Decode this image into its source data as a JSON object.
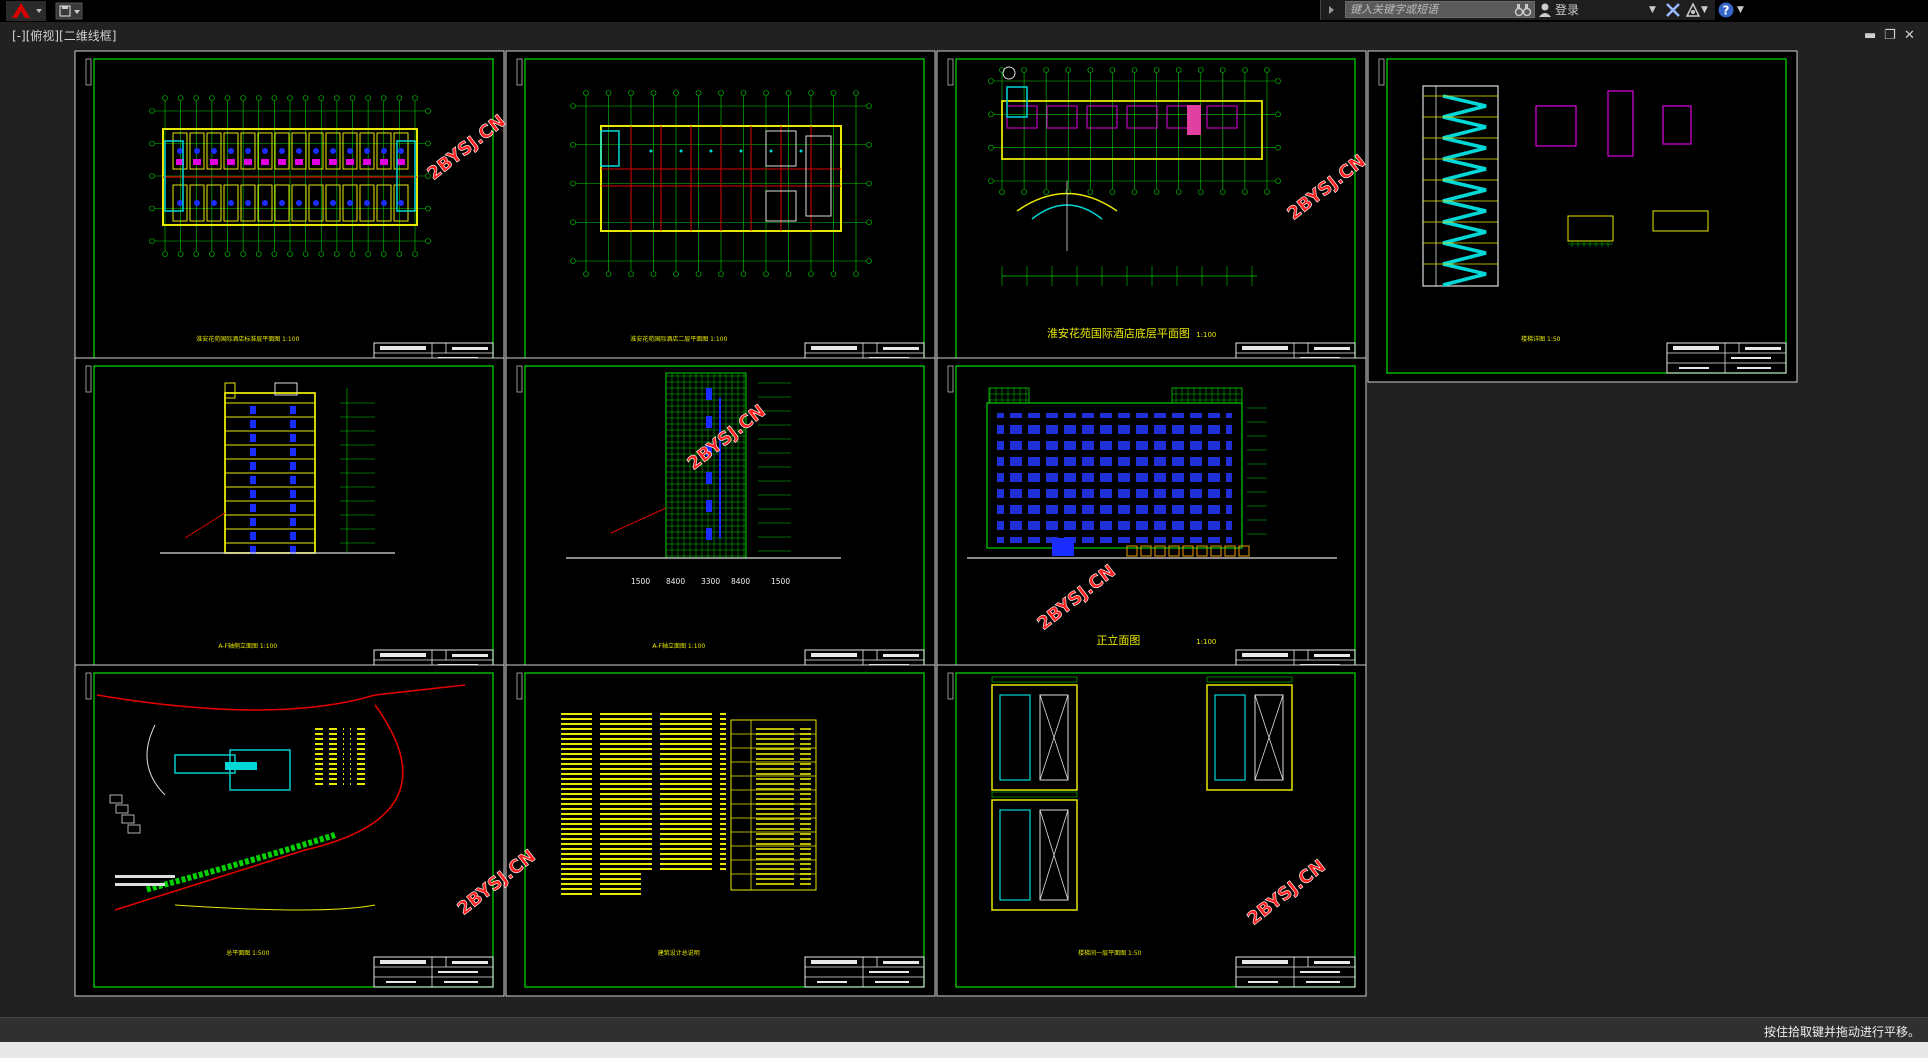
{
  "titlebar": {
    "search_placeholder": "键入关键字或短语",
    "login_label": "登录"
  },
  "viewport": {
    "view_label": "[-][俯视][二维线框]"
  },
  "colors": {
    "sheet_border": "#00d000",
    "cad_yellow": "#e8e800",
    "cad_red": "#e00000",
    "cad_blue": "#1a2cff",
    "cad_cyan": "#00d8d8",
    "cad_magenta": "#e000e0",
    "watermark": "#ff2020",
    "background": "#212121"
  },
  "sheets": [
    {
      "title": "淮安花苑国际酒店标准层平面图 1:100",
      "scale": ""
    },
    {
      "title": "淮安花苑国际酒店二层平面图 1:100",
      "scale": ""
    },
    {
      "title": "淮安花苑国际酒店底层平面图",
      "scale": "1:100"
    },
    {
      "title": "楼梯详图 1:50",
      "scale": ""
    },
    {
      "title": "A-F轴侧立面图 1:100",
      "scale": ""
    },
    {
      "title": "A-F轴立面图 1:100",
      "scale": ""
    },
    {
      "title": "正立面图",
      "scale": "1:100"
    },
    {
      "title": "总平面图 1:500",
      "scale": ""
    },
    {
      "title": "建筑设计总说明",
      "scale": ""
    },
    {
      "title": "楼梯间一层平面图 1:50",
      "scale": ""
    }
  ],
  "dims": {
    "elev_a": [
      "1500",
      "8400",
      "3300",
      "8400",
      "1500"
    ]
  },
  "watermarks": [
    "2BYSJ.CN",
    "2BYSJ.CN",
    "2BYSJ.CN",
    "2BYSJ.CN",
    "2BYSJ.CN",
    "2BYSJ.CN"
  ],
  "status": {
    "message": "按住拾取键并拖动进行平移。"
  }
}
